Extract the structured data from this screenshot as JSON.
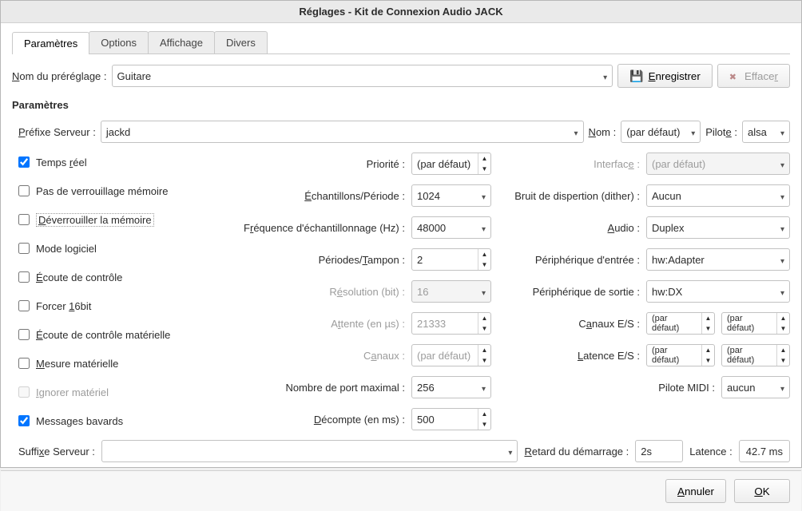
{
  "title": "Réglages - Kit de Connexion Audio JACK",
  "tabs": [
    "Paramètres",
    "Options",
    "Affichage",
    "Divers"
  ],
  "preset": {
    "label": "Nom du préréglage :",
    "value": "Guitare"
  },
  "save_label": "Enregistrer",
  "clear_label": "Effacer",
  "section_title": "Paramètres",
  "prefix": {
    "label": "Préfixe Serveur :",
    "value": "jackd"
  },
  "name": {
    "label": "Nom :",
    "value": "(par défaut)"
  },
  "driver": {
    "label": "Pilote :",
    "value": "alsa"
  },
  "checks": [
    {
      "label": "Temps réel",
      "checked": true,
      "disabled": false
    },
    {
      "label": "Pas de verrouillage mémoire",
      "checked": false,
      "disabled": false
    },
    {
      "label": "Déverrouiller la mémoire",
      "checked": false,
      "disabled": false,
      "boxed": true
    },
    {
      "label": "Mode logiciel",
      "checked": false,
      "disabled": false
    },
    {
      "label": "Écoute de contrôle",
      "checked": false,
      "disabled": false
    },
    {
      "label": "Forcer 16bit",
      "checked": false,
      "disabled": false
    },
    {
      "label": "Écoute de contrôle matérielle",
      "checked": false,
      "disabled": false
    },
    {
      "label": "Mesure matérielle",
      "checked": false,
      "disabled": false
    },
    {
      "label": "Ignorer matériel",
      "checked": false,
      "disabled": true
    },
    {
      "label": "Messages bavards",
      "checked": true,
      "disabled": false
    }
  ],
  "mid": {
    "priority": {
      "label": "Priorité :",
      "value": "(par défaut)"
    },
    "frames_per_period": {
      "label": "Échantillons/Période :",
      "value": "1024"
    },
    "sample_rate": {
      "label": "Fréquence d'échantillonnage (Hz) :",
      "value": "48000"
    },
    "periods_buffer": {
      "label": "Périodes/Tampon :",
      "value": "2"
    },
    "resolution": {
      "label": "Résolution (bit) :",
      "value": "16",
      "disabled": true
    },
    "wait": {
      "label": "Attente (en µs) :",
      "value": "21333",
      "disabled": true
    },
    "channels": {
      "label": "Canaux :",
      "value": "(par défaut)",
      "disabled": true
    },
    "max_ports": {
      "label": "Nombre de port maximal :",
      "value": "256"
    },
    "countdown": {
      "label": "Décompte (en ms) :",
      "value": "500"
    }
  },
  "right": {
    "interface": {
      "label": "Interface :",
      "value": "(par défaut)",
      "disabled": true
    },
    "dither": {
      "label": "Bruit de dispertion (dither) :",
      "value": "Aucun"
    },
    "audio": {
      "label": "Audio :",
      "value": "Duplex"
    },
    "in_dev": {
      "label": "Périphérique d'entrée :",
      "value": "hw:Adapter"
    },
    "out_dev": {
      "label": "Périphérique de sortie :",
      "value": "hw:DX"
    },
    "io_channels": {
      "label": "Canaux E/S :",
      "in": "(par défaut)",
      "out": "(par défaut)"
    },
    "io_latency": {
      "label": "Latence E/S :",
      "in": "(par défaut)",
      "out": "(par défaut)"
    },
    "midi_driver": {
      "label": "Pilote MIDI :",
      "value": "aucun"
    }
  },
  "bottom": {
    "suffix_label": "Suffixe Serveur :",
    "suffix_value": "",
    "startup_delay_label": "Retard du démarrage :",
    "startup_delay_value": "2s",
    "latency_label": "Latence :",
    "latency_value": "42.7 ms"
  },
  "footer": {
    "cancel": "Annuler",
    "ok": "OK"
  }
}
